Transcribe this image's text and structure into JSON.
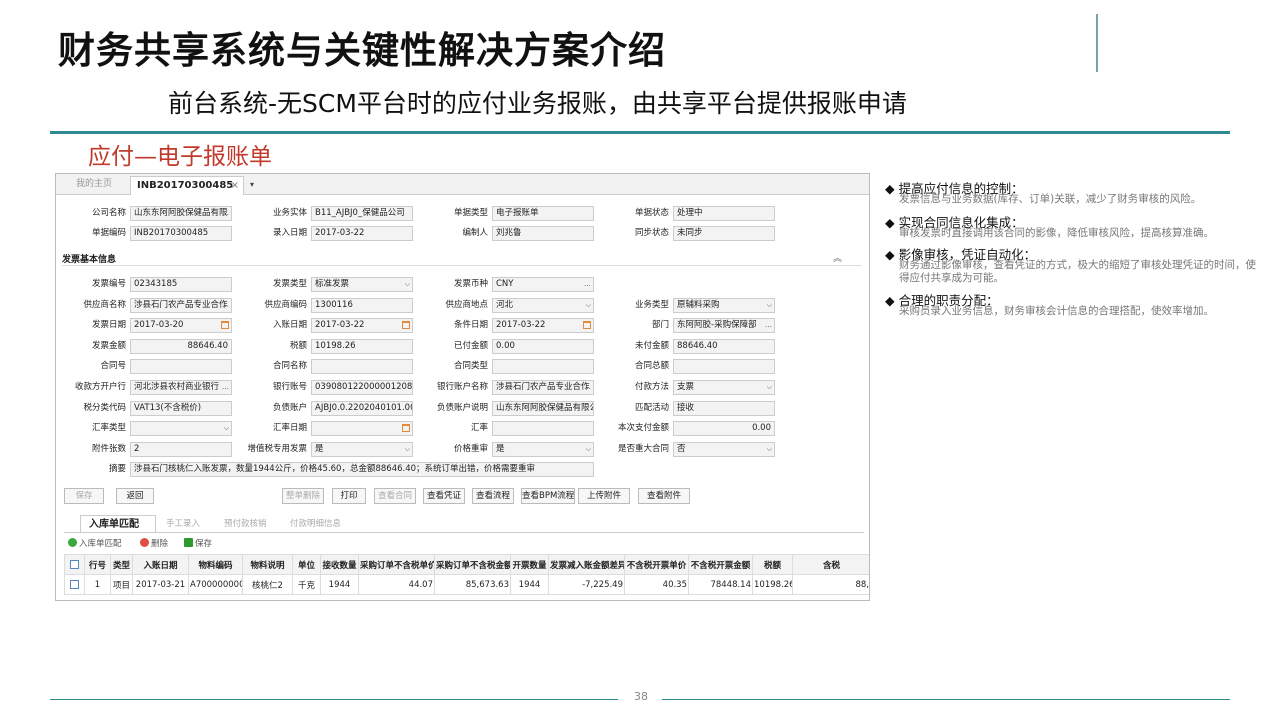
{
  "slide": {
    "title": "财务共享系统与关键性解决方案介绍",
    "subtitle": "前台系统-无SCM平台时的应付业务报账，由共享平台提供报账申请",
    "section_title": "应付—电子报账单",
    "page_number": "38",
    "accent": "#2c8c8f",
    "section_color": "#c0392b"
  },
  "window": {
    "tabs": {
      "home": "我的主页",
      "doc": "INB20170300485",
      "close": "×",
      "more": "▾"
    },
    "section_label": "发票基本信息",
    "section_chevron": "︽"
  },
  "header_fields": [
    {
      "label": "公司名称",
      "value": "山东东阿阿胶保健品有限",
      "icon": "…"
    },
    {
      "label": "业务实体",
      "value": "B11_AJBJ0_保健品公司"
    },
    {
      "label": "单据类型",
      "value": "电子报账单"
    },
    {
      "label": "单据状态",
      "value": "处理中"
    },
    {
      "label": "单据编码",
      "value": "INB20170300485"
    },
    {
      "label": "录入日期",
      "value": "2017-03-22"
    },
    {
      "label": "编制人",
      "value": "刘兆鲁"
    },
    {
      "label": "同步状态",
      "value": "未同步"
    }
  ],
  "invoice_fields": [
    {
      "label": "发票编号",
      "value": "02343185"
    },
    {
      "label": "发票类型",
      "value": "标准发票",
      "icon": "⌵"
    },
    {
      "label": "发票币种",
      "value": "CNY",
      "icon": "…"
    },
    {
      "label": "",
      "value": ""
    },
    {
      "label": "供应商名称",
      "value": "涉县石门农产品专业合作",
      "icon": "…"
    },
    {
      "label": "供应商编码",
      "value": "1300116"
    },
    {
      "label": "供应商地点",
      "value": "河北",
      "icon": "⌵"
    },
    {
      "label": "业务类型",
      "value": "原辅料采购",
      "icon": "⌵"
    },
    {
      "label": "发票日期",
      "value": "2017-03-20",
      "icon": "cal"
    },
    {
      "label": "入账日期",
      "value": "2017-03-22",
      "icon": "cal"
    },
    {
      "label": "条件日期",
      "value": "2017-03-22",
      "icon": "cal"
    },
    {
      "label": "部门",
      "value": "东阿阿胶-采购保障部",
      "icon": "…"
    },
    {
      "label": "发票金额",
      "value": "88646.40",
      "align": "r"
    },
    {
      "label": "税额",
      "value": "10198.26"
    },
    {
      "label": "已付金额",
      "value": "0.00"
    },
    {
      "label": "未付金额",
      "value": "88646.40"
    },
    {
      "label": "合同号",
      "value": ""
    },
    {
      "label": "合同名称",
      "value": ""
    },
    {
      "label": "合同类型",
      "value": ""
    },
    {
      "label": "合同总额",
      "value": ""
    },
    {
      "label": "收款方开户行",
      "value": "河北涉县农村商业银行",
      "icon": "…"
    },
    {
      "label": "银行账号",
      "value": "039080122000001208"
    },
    {
      "label": "银行账户名称",
      "value": "涉县石门农产品专业合作",
      "icon": "…"
    },
    {
      "label": "付款方法",
      "value": "支票",
      "icon": "⌵"
    },
    {
      "label": "税分类代码",
      "value": "VAT13(不含税价)"
    },
    {
      "label": "负债账户",
      "value": "AJBJ0.0.2202040101.000"
    },
    {
      "label": "负债账户说明",
      "value": "山东东阿阿胶保健品有限公"
    },
    {
      "label": "匹配活动",
      "value": "接收"
    },
    {
      "label": "汇率类型",
      "value": "",
      "icon": "⌵"
    },
    {
      "label": "汇率日期",
      "value": "",
      "icon": "cal"
    },
    {
      "label": "汇率",
      "value": ""
    },
    {
      "label": "本次支付金额",
      "value": "0.00",
      "align": "r"
    },
    {
      "label": "附件张数",
      "value": "2"
    },
    {
      "label": "增值税专用发票",
      "value": "是",
      "icon": "⌵"
    },
    {
      "label": "价格重审",
      "value": "是",
      "icon": "⌵"
    },
    {
      "label": "是否重大合同",
      "value": "否",
      "icon": "⌵"
    }
  ],
  "summary": {
    "label": "摘要",
    "value": "涉县石门核桃仁入账发票，数量1944公斤，价格45.60，总金额88646.40；系统订单出错，价格需要重审"
  },
  "buttons": [
    {
      "label": "保存",
      "disabled": true
    },
    {
      "label": "返回"
    },
    {
      "label": "整单删除",
      "disabled": true
    },
    {
      "label": "打印"
    },
    {
      "label": "查看合同",
      "disabled": true
    },
    {
      "label": "查看凭证"
    },
    {
      "label": "查看流程"
    },
    {
      "label": "查看BPM流程"
    },
    {
      "label": "上传附件"
    },
    {
      "label": "查看附件"
    }
  ],
  "sub_tabs": [
    "入库单匹配",
    "手工录入",
    "预付款核销",
    "付款明细信息"
  ],
  "toolbar": {
    "add": "入库单匹配",
    "delete": "删除",
    "save": "保存",
    "add_color": "#3aa83a",
    "delete_color": "#e05040",
    "save_color": "#2e9a2e"
  },
  "table": {
    "columns": [
      "",
      "行号",
      "类型",
      "入账日期",
      "物料编码",
      "物料说明",
      "单位",
      "接收数量",
      "采购订单不含税单价",
      "采购订单不含税金额",
      "开票数量",
      "发票减入账金额差异",
      "不含税开票单价",
      "不含税开票金额",
      "税额",
      "含税"
    ],
    "rows": [
      [
        "",
        "1",
        "项目",
        "2017-03-21",
        "A700000000",
        "核桃仁2",
        "千克",
        "1944",
        "44.07",
        "85,673.63",
        "1944",
        "-7,225.49",
        "40.35",
        "78448.14",
        "10198.26",
        "88,"
      ]
    ]
  },
  "bullets": [
    {
      "head": "◆ 提高应付信息的控制：",
      "body": "发票信息与业务数据(库存、订单)关联，减少了财务审核的风险。"
    },
    {
      "head": "◆ 实现合同信息化集成：",
      "body": "审核发票时直接调用该合同的影像，降低审核风险，提高核算准确。"
    },
    {
      "head": "◆ 影像审核，凭证自动化：",
      "body": "财务通过影像审核，查看凭证的方式，极大的缩短了审核处理凭证的时间，使得应付共享成为可能。"
    },
    {
      "head": "◆ 合理的职责分配：",
      "body": "采购员录入业务信息，财务审核会计信息的合理搭配，使效率增加。"
    }
  ]
}
